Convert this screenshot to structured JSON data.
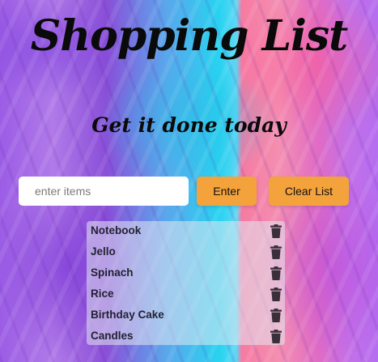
{
  "header": {
    "title": "Shopping List",
    "subtitle": "Get it done today"
  },
  "form": {
    "placeholder": "enter items",
    "value": "",
    "enter_label": "Enter",
    "clear_label": "Clear List"
  },
  "list": {
    "items": [
      {
        "label": "Notebook",
        "icon": "trash-icon"
      },
      {
        "label": "Jello",
        "icon": "trash-icon"
      },
      {
        "label": "Spinach",
        "icon": "trash-icon"
      },
      {
        "label": "Rice",
        "icon": "trash-icon"
      },
      {
        "label": "Birthday Cake",
        "icon": "trash-icon"
      },
      {
        "label": "Candles",
        "icon": "trash-icon"
      }
    ]
  },
  "colors": {
    "button": "#f4a23c",
    "text": "#0a0a0a",
    "trash": "#3a2e3a"
  }
}
